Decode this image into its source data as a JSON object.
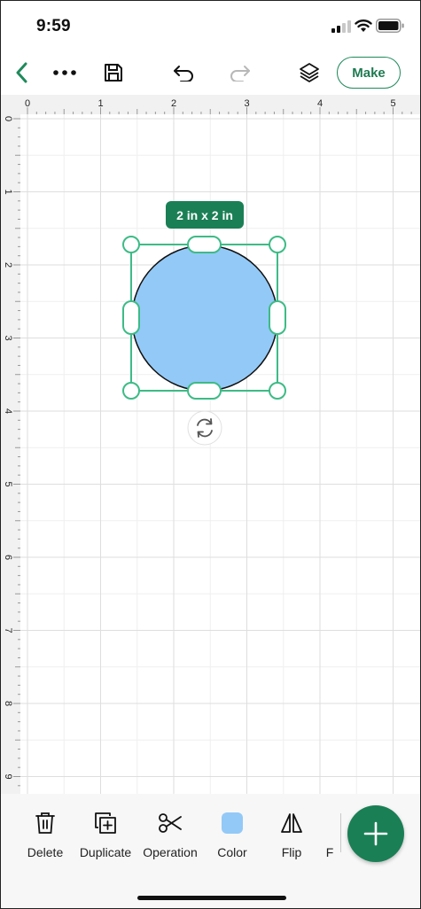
{
  "status_bar": {
    "time": "9:59"
  },
  "toolbar": {
    "back_icon": "chevron-left-icon",
    "more_icon": "more-dots-icon",
    "save_icon": "save-icon",
    "undo_icon": "undo-icon",
    "redo_icon": "redo-icon",
    "layers_icon": "layers-icon",
    "make_label": "Make"
  },
  "canvas": {
    "ruler_x_labels": [
      "0",
      "1",
      "2",
      "3",
      "4",
      "5"
    ],
    "ruler_y_labels": [
      "0",
      "1",
      "2",
      "3",
      "4",
      "5",
      "6",
      "7",
      "8",
      "9"
    ],
    "shape": {
      "type": "circle",
      "fill": "#93c9f7",
      "stroke": "#111111"
    },
    "selection_color": "#3dbb86",
    "size_badge": "2 in x 2 in",
    "rotate_icon": "rotate-icon"
  },
  "bottom_bar": {
    "tools": [
      {
        "label": "Delete",
        "icon": "trash-icon"
      },
      {
        "label": "Duplicate",
        "icon": "duplicate-icon"
      },
      {
        "label": "Operation",
        "icon": "scissors-icon"
      },
      {
        "label": "Color",
        "icon": "color-swatch-icon",
        "swatch": "#93c9f7"
      },
      {
        "label": "Flip",
        "icon": "flip-icon"
      },
      {
        "label": "F",
        "icon": "truncated-tool-icon"
      }
    ],
    "add_icon": "plus-icon"
  },
  "colors": {
    "accent": "#1a7f55",
    "grid": "#e4e4e4"
  }
}
